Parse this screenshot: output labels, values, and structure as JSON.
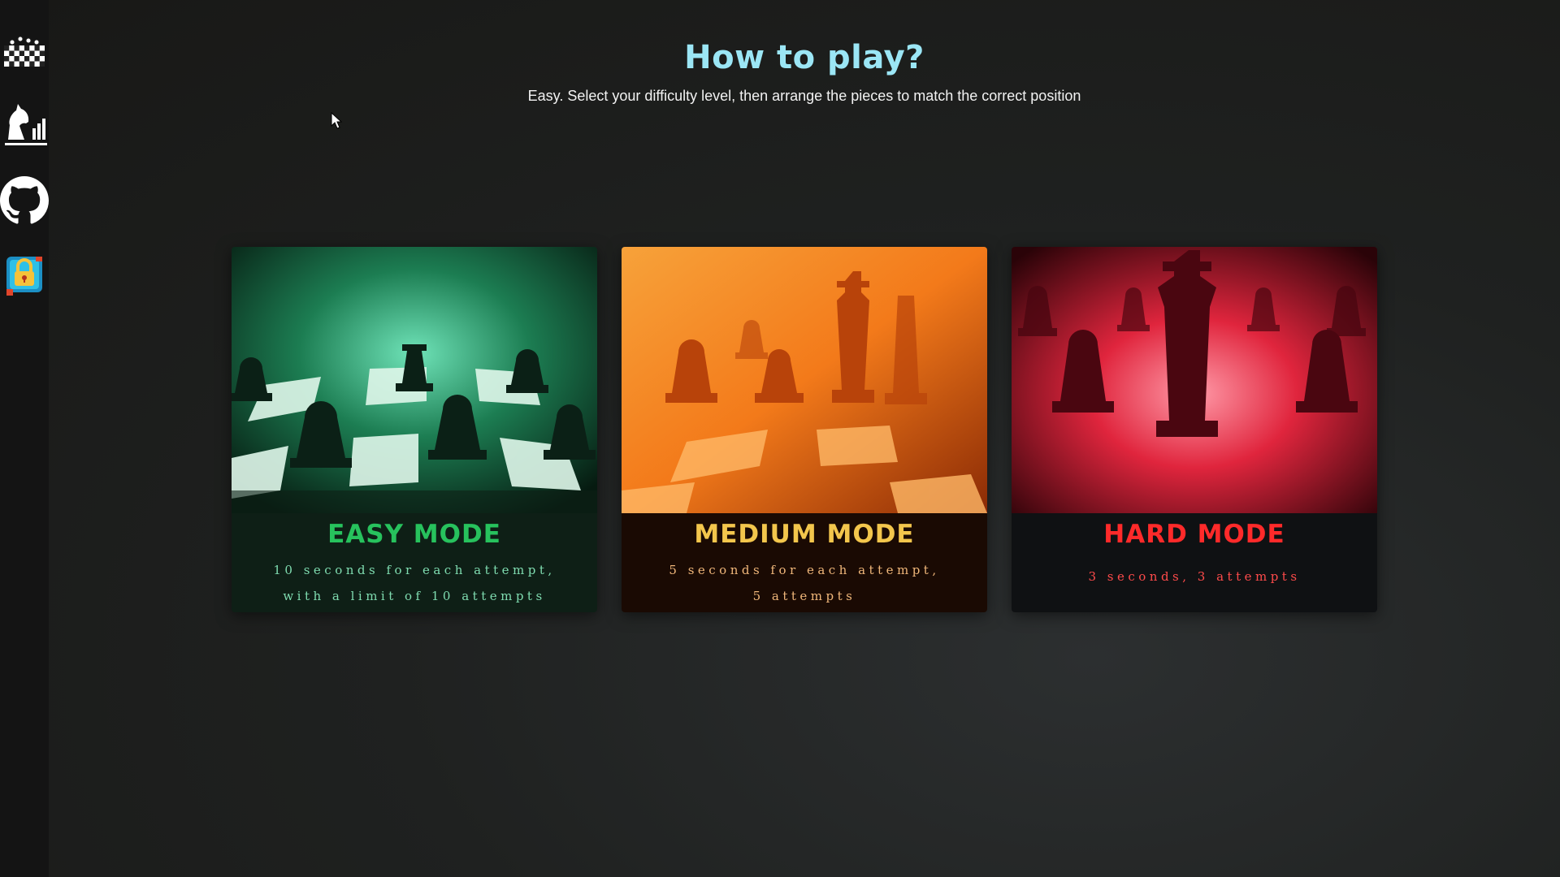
{
  "sidebar": {
    "items": [
      {
        "name": "chessboard-logo",
        "icon": "chessboard-icon"
      },
      {
        "name": "stats",
        "icon": "knight-chart-icon"
      },
      {
        "name": "github",
        "icon": "github-icon"
      },
      {
        "name": "lock-app",
        "icon": "padlock-icon"
      }
    ]
  },
  "header": {
    "title": "How to play?",
    "subtitle": "Easy. Select your difficulty level, then arrange the pieces to match the correct position"
  },
  "modes": [
    {
      "title": "EASY MODE",
      "desc_line1": "10 seconds for each attempt,",
      "desc_line2": "with a limit of 10 attempts",
      "accent": "#27c25d"
    },
    {
      "title": "MEDIUM MODE",
      "desc_line1": "5 seconds for each attempt,",
      "desc_line2": "5 attempts",
      "accent": "#f3c64c"
    },
    {
      "title": "HARD MODE",
      "desc_line1": "3 seconds, 3 attempts",
      "accent": "#ff2a2a"
    }
  ]
}
